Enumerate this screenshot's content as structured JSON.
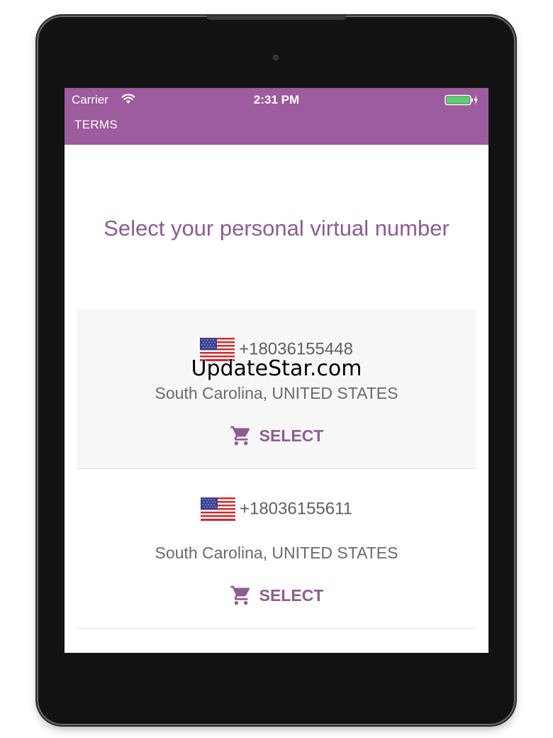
{
  "status_bar": {
    "carrier": "Carrier",
    "time": "2:31 PM"
  },
  "nav": {
    "terms_label": "TERMS"
  },
  "page": {
    "title": "Select your personal virtual number"
  },
  "numbers": [
    {
      "phone": "+18036155448",
      "location": "South Carolina, UNITED STATES",
      "select_label": "SELECT",
      "flag": "us-flag-icon"
    },
    {
      "phone": "+18036155611",
      "location": "South Carolina, UNITED STATES",
      "select_label": "SELECT",
      "flag": "us-flag-icon"
    }
  ],
  "watermark": "UpdateStar.com",
  "colors": {
    "accent": "#9c5c9d",
    "title": "#8e5b93",
    "battery": "#4cd964"
  }
}
